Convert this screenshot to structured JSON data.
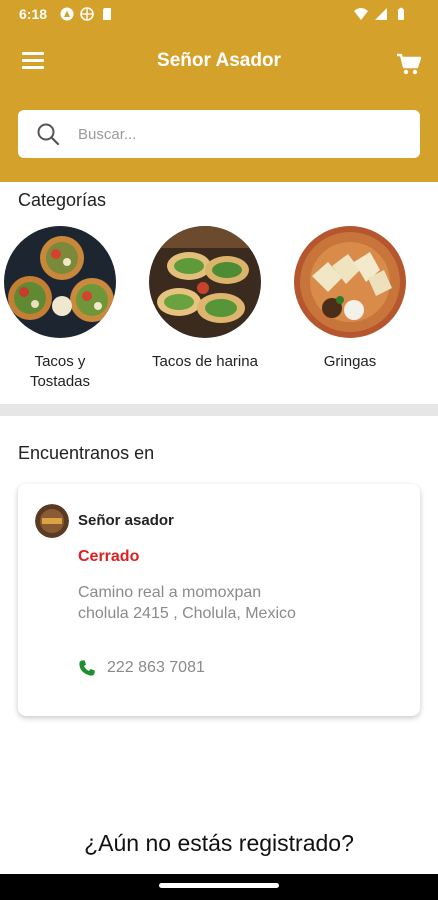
{
  "status_bar": {
    "time": "6:18"
  },
  "app_bar": {
    "title": "Señor Asador"
  },
  "search": {
    "placeholder": "Buscar..."
  },
  "categories": {
    "title": "Categorías",
    "items": [
      {
        "label": "Tacos y Tostadas"
      },
      {
        "label": "Tacos de harina"
      },
      {
        "label": "Gringas"
      }
    ]
  },
  "locations": {
    "title": "Encuentranos en",
    "store": {
      "name": "Señor asador",
      "status": "Cerrado",
      "address": "Camino real a momoxpan cholula 2415 , Cholula, Mexico",
      "phone": "222 863 7081"
    }
  },
  "register_prompt": "¿Aún no estás registrado?",
  "colors": {
    "brand": "#D4A12A",
    "closed": "#E02020",
    "phone_icon": "#1E8E2E"
  }
}
